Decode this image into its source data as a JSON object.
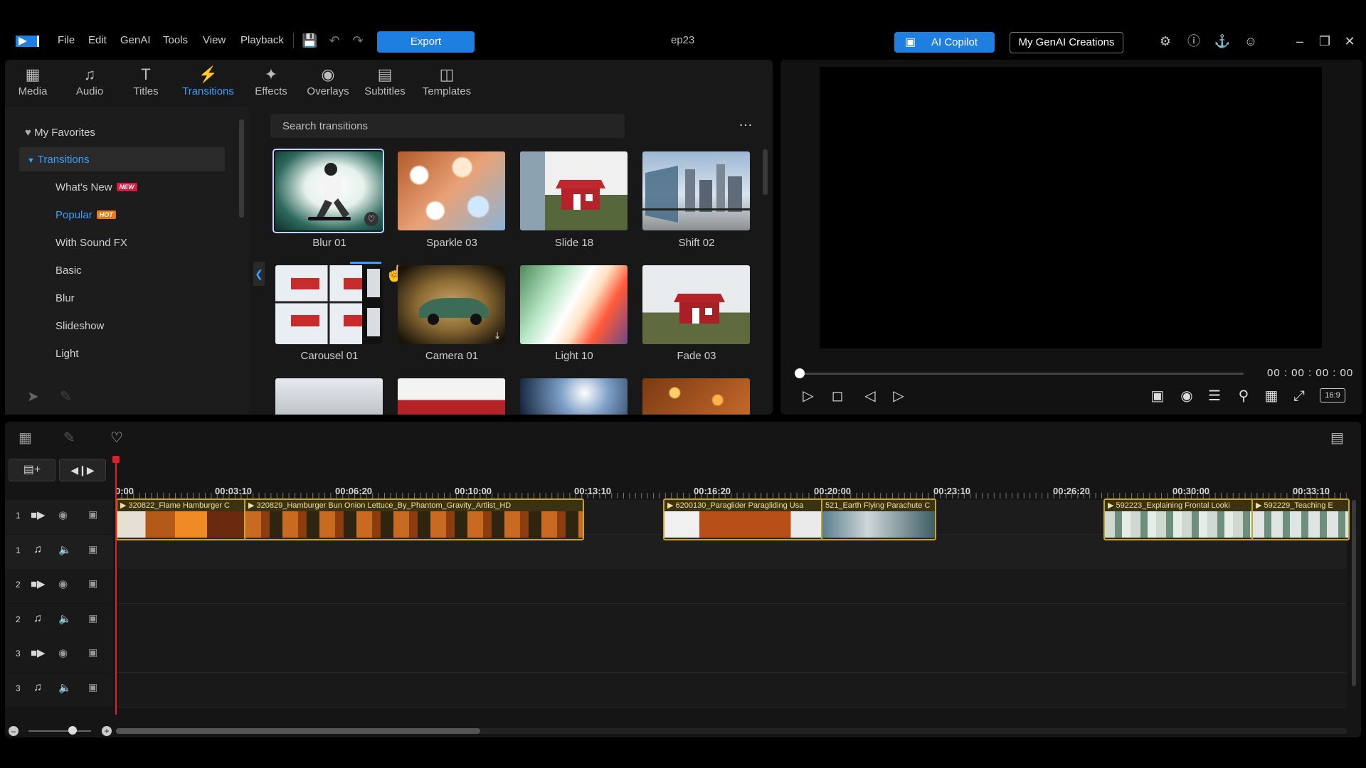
{
  "menu": [
    "File",
    "Edit",
    "GenAI",
    "Tools",
    "View",
    "Playback"
  ],
  "export_label": "Export",
  "project_name": "ep23",
  "ai_copilot_label": "AI Copilot",
  "my_genai_label": "My GenAI Creations",
  "tabs": [
    {
      "label": "Media",
      "icon": "media-icon"
    },
    {
      "label": "Audio",
      "icon": "audio-icon"
    },
    {
      "label": "Titles",
      "icon": "titles-icon"
    },
    {
      "label": "Transitions",
      "icon": "transitions-icon",
      "active": true
    },
    {
      "label": "Effects",
      "icon": "effects-icon"
    },
    {
      "label": "Overlays",
      "icon": "overlays-icon"
    },
    {
      "label": "Subtitles",
      "icon": "subtitles-icon"
    },
    {
      "label": "Templates",
      "icon": "templates-icon"
    }
  ],
  "sidebar": {
    "favorites": "My Favorites",
    "category": "Transitions",
    "items": [
      {
        "label": "What's New",
        "badge": "NEW"
      },
      {
        "label": "Popular",
        "badge": "HOT"
      },
      {
        "label": "With Sound FX"
      },
      {
        "label": "Basic"
      },
      {
        "label": "Blur"
      },
      {
        "label": "Slideshow"
      },
      {
        "label": "Light"
      }
    ]
  },
  "search_placeholder": "Search transitions",
  "more_label": "…",
  "transitions": [
    {
      "name": "Blur 01",
      "selected": true
    },
    {
      "name": "Sparkle 03"
    },
    {
      "name": "Slide 18"
    },
    {
      "name": "Shift 02"
    },
    {
      "name": "Carousel 01"
    },
    {
      "name": "Camera 01"
    },
    {
      "name": "Light 10"
    },
    {
      "name": "Fade 03"
    }
  ],
  "timecode": "00 : 00 : 00 : 00",
  "aspect_ratio": "16:9",
  "ruler_ticks": [
    "0:00",
    "00:03:10",
    "00:06:20",
    "00:10:00",
    "00:13:10",
    "00:16:20",
    "00:20:00",
    "00:23:10",
    "00:26:20",
    "00:30:00",
    "00:33:10"
  ],
  "tracks": [
    {
      "num": "1",
      "type": "video"
    },
    {
      "num": "1",
      "type": "audio"
    },
    {
      "num": "2",
      "type": "video"
    },
    {
      "num": "2",
      "type": "audio"
    },
    {
      "num": "3",
      "type": "video"
    },
    {
      "num": "3",
      "type": "audio"
    }
  ],
  "clips": [
    {
      "label": "320822_Flame Hamburger C"
    },
    {
      "label": "320829_Hamburger Bun Onion Lettuce_By_Phantom_Gravity_Artlist_HD"
    },
    {
      "label": "6200130_Paraglider Paragliding Usa"
    },
    {
      "label": "521_Earth Flying Parachute C"
    },
    {
      "label": "592223_Explaining Frontal Looki"
    },
    {
      "label": "592229_Teaching E"
    }
  ],
  "colors": {
    "accent": "#1f7fe0",
    "active_tab": "#3aa0ff",
    "clip_border": "#c9a227",
    "playhead": "#e0202a"
  }
}
